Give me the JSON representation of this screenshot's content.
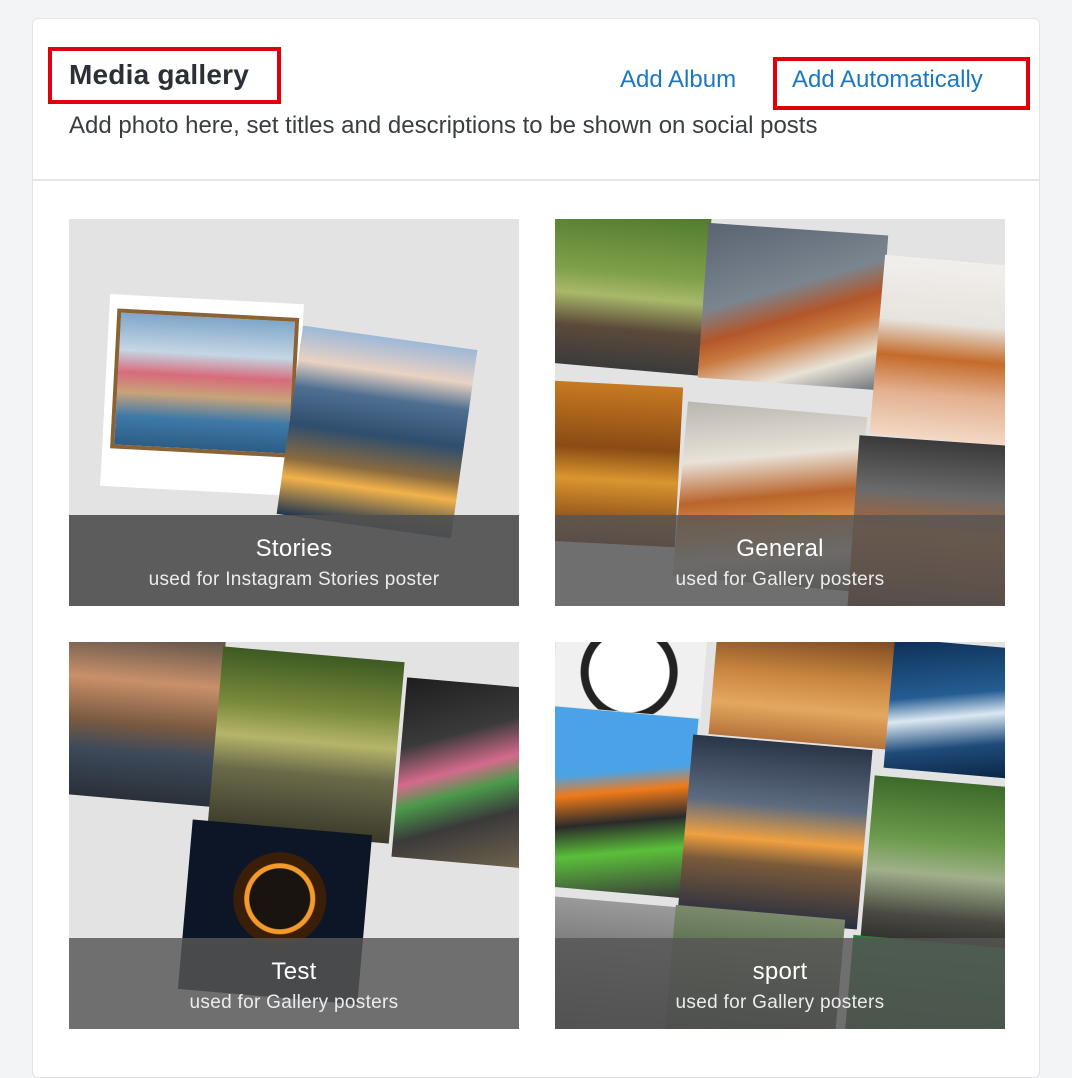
{
  "header": {
    "title": "Media gallery",
    "subtitle": "Add photo here, set titles and descriptions to be shown on social posts",
    "actions": {
      "add_album": "Add Album",
      "add_automatically": "Add Automatically"
    }
  },
  "albums": [
    {
      "name": "Stories",
      "description": "used for Instagram Stories poster"
    },
    {
      "name": "General",
      "description": "used for Gallery posters"
    },
    {
      "name": "Test",
      "description": "used for Gallery posters"
    },
    {
      "name": "sport",
      "description": "used for Gallery posters"
    }
  ],
  "colors": {
    "link": "#1a78c2",
    "highlight": "#e0000b",
    "overlay": "#505050"
  }
}
